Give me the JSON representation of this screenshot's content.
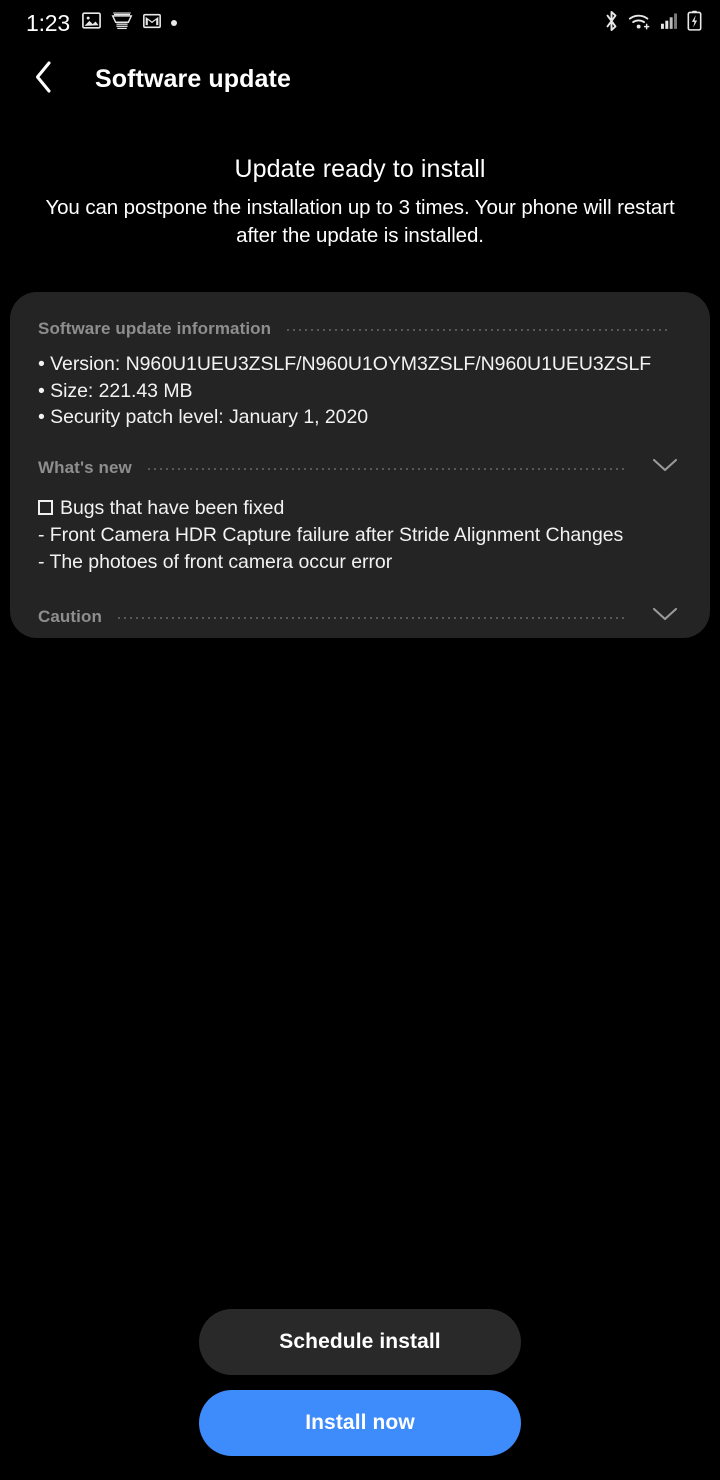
{
  "status_bar": {
    "time": "1:23",
    "left_icons": [
      {
        "name": "photos-icon",
        "glyph": "image"
      },
      {
        "name": "keyboard-icon",
        "glyph": "keyboard"
      },
      {
        "name": "gmail-icon",
        "glyph": "envelope-m"
      },
      {
        "name": "notification-dot-icon",
        "glyph": "dot"
      }
    ],
    "right_icons": [
      {
        "name": "bluetooth-icon",
        "glyph": "bluetooth"
      },
      {
        "name": "wifi-icon",
        "glyph": "wifi"
      },
      {
        "name": "cellular-signal-icon",
        "glyph": "signal-bars"
      },
      {
        "name": "battery-charging-icon",
        "glyph": "battery-bolt"
      }
    ]
  },
  "app_bar": {
    "back_label": "Back",
    "title": "Software update"
  },
  "headline": {
    "title": "Update ready to install",
    "description": "You can postpone the installation up to 3 times. Your phone will restart after the update is installed."
  },
  "info_card": {
    "sections": {
      "software_update_information": {
        "label": "Software update information",
        "items": [
          "• Version: N960U1UEU3ZSLF/N960U1OYM3ZSLF/N960U1UEU3ZSLF",
          "• Size: 221.43 MB",
          "• Security patch level: January 1, 2020"
        ]
      },
      "whats_new": {
        "label": "What's new",
        "expanded": true,
        "heading": "Bugs that have been fixed",
        "items": [
          "- Front Camera HDR Capture failure after Stride Alignment Changes",
          "- The photoes of front camera occur error"
        ]
      },
      "caution": {
        "label": "Caution",
        "expanded": false
      }
    }
  },
  "buttons": {
    "schedule_install": "Schedule install",
    "install_now": "Install now"
  },
  "colors": {
    "page_background": "#000000",
    "card_background": "#242424",
    "primary_button": "#3E8BFB",
    "secondary_button": "#292929",
    "section_label": "#8e8e8e",
    "body_text": "#f2f2f2"
  }
}
